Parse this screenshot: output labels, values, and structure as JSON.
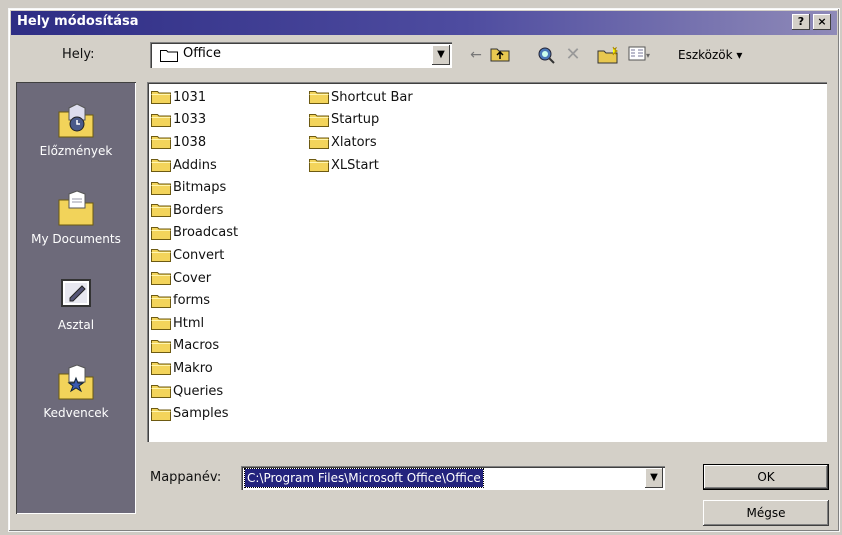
{
  "title": "Hely módosítása",
  "title_buttons": {
    "help": "?",
    "close": "×"
  },
  "look_in": {
    "label": "Hely:",
    "value": "Office"
  },
  "toolbar": {
    "tools_label": "Eszközök ▾"
  },
  "places": [
    {
      "label": "Előzmények",
      "icon": "history-folder-icon"
    },
    {
      "label": "My Documents",
      "icon": "my-documents-icon"
    },
    {
      "label": "Asztal",
      "icon": "desktop-icon"
    },
    {
      "label": "Kedvencek",
      "icon": "favorites-icon"
    }
  ],
  "files_col1": [
    "1031",
    "1033",
    "1038",
    "Addins",
    "Bitmaps",
    "Borders",
    "Broadcast",
    "Convert",
    "Cover",
    "forms",
    "Html",
    "Macros",
    "Makro",
    "Queries",
    "Samples"
  ],
  "files_col2": [
    "Shortcut Bar",
    "Startup",
    "Xlators",
    "XLStart"
  ],
  "folder_name": {
    "label": "Mappanév:",
    "value": "C:\\Program Files\\Microsoft Office\\Office"
  },
  "buttons": {
    "ok": "OK",
    "cancel": "Mégse"
  }
}
